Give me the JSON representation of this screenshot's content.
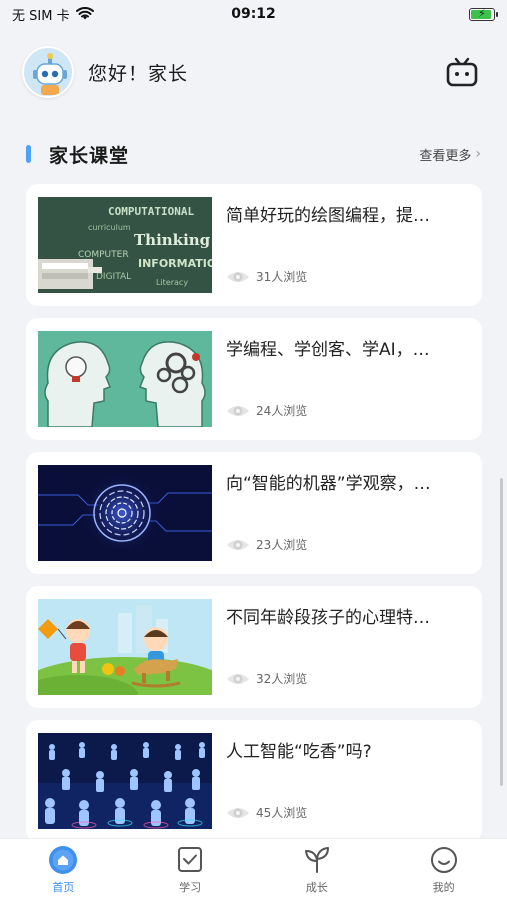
{
  "status_bar": {
    "carrier": "无 SIM 卡",
    "time": "09:12",
    "icons": [
      "wifi-icon",
      "battery-charging-icon"
    ]
  },
  "header": {
    "greeting": "您好！家长",
    "avatar_icon": "robot-avatar",
    "right_icon": "tv-icon"
  },
  "section": {
    "title": "家长课堂",
    "more_label": "查看更多",
    "accent_color": "#4fa3f7"
  },
  "articles": [
    {
      "title": "简单好玩的绘图编程，提…",
      "views": "31人浏览",
      "thumb": "computational-thinking-words"
    },
    {
      "title": "学编程、学创客、学AI，…",
      "views": "24人浏览",
      "thumb": "head-silhouettes-gears"
    },
    {
      "title": "向“智能的机器”学观察，…",
      "views": "23人浏览",
      "thumb": "fingerprint-circuit"
    },
    {
      "title": "不同年龄段孩子的心理特…",
      "views": "32人浏览",
      "thumb": "kids-playing"
    },
    {
      "title": "人工智能“吃香”吗?",
      "views": "45人浏览",
      "thumb": "network-people"
    }
  ],
  "tabbar": {
    "active_color": "#3d8ff0",
    "tabs": [
      {
        "label": "首页",
        "icon": "home-icon",
        "active": true
      },
      {
        "label": "学习",
        "icon": "study-check-icon",
        "active": false
      },
      {
        "label": "成长",
        "icon": "sprout-icon",
        "active": false
      },
      {
        "label": "我的",
        "icon": "smile-face-icon",
        "active": false
      }
    ]
  }
}
